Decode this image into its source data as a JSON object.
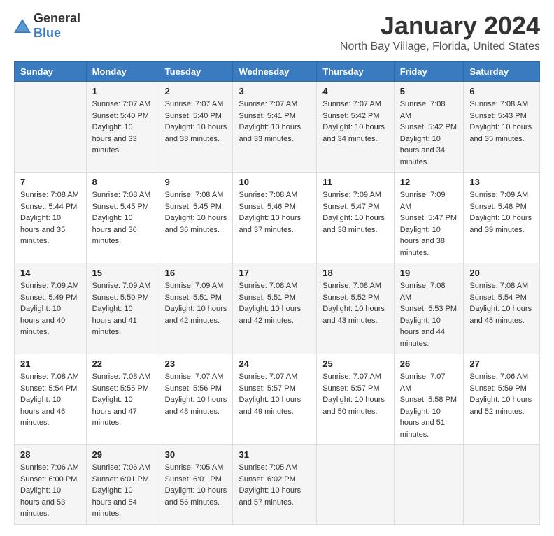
{
  "logo": {
    "general": "General",
    "blue": "Blue"
  },
  "header": {
    "title": "January 2024",
    "subtitle": "North Bay Village, Florida, United States"
  },
  "weekdays": [
    "Sunday",
    "Monday",
    "Tuesday",
    "Wednesday",
    "Thursday",
    "Friday",
    "Saturday"
  ],
  "weeks": [
    [
      {
        "day": "",
        "sunrise": "",
        "sunset": "",
        "daylight": ""
      },
      {
        "day": "1",
        "sunrise": "Sunrise: 7:07 AM",
        "sunset": "Sunset: 5:40 PM",
        "daylight": "Daylight: 10 hours and 33 minutes."
      },
      {
        "day": "2",
        "sunrise": "Sunrise: 7:07 AM",
        "sunset": "Sunset: 5:40 PM",
        "daylight": "Daylight: 10 hours and 33 minutes."
      },
      {
        "day": "3",
        "sunrise": "Sunrise: 7:07 AM",
        "sunset": "Sunset: 5:41 PM",
        "daylight": "Daylight: 10 hours and 33 minutes."
      },
      {
        "day": "4",
        "sunrise": "Sunrise: 7:07 AM",
        "sunset": "Sunset: 5:42 PM",
        "daylight": "Daylight: 10 hours and 34 minutes."
      },
      {
        "day": "5",
        "sunrise": "Sunrise: 7:08 AM",
        "sunset": "Sunset: 5:42 PM",
        "daylight": "Daylight: 10 hours and 34 minutes."
      },
      {
        "day": "6",
        "sunrise": "Sunrise: 7:08 AM",
        "sunset": "Sunset: 5:43 PM",
        "daylight": "Daylight: 10 hours and 35 minutes."
      }
    ],
    [
      {
        "day": "7",
        "sunrise": "Sunrise: 7:08 AM",
        "sunset": "Sunset: 5:44 PM",
        "daylight": "Daylight: 10 hours and 35 minutes."
      },
      {
        "day": "8",
        "sunrise": "Sunrise: 7:08 AM",
        "sunset": "Sunset: 5:45 PM",
        "daylight": "Daylight: 10 hours and 36 minutes."
      },
      {
        "day": "9",
        "sunrise": "Sunrise: 7:08 AM",
        "sunset": "Sunset: 5:45 PM",
        "daylight": "Daylight: 10 hours and 36 minutes."
      },
      {
        "day": "10",
        "sunrise": "Sunrise: 7:08 AM",
        "sunset": "Sunset: 5:46 PM",
        "daylight": "Daylight: 10 hours and 37 minutes."
      },
      {
        "day": "11",
        "sunrise": "Sunrise: 7:09 AM",
        "sunset": "Sunset: 5:47 PM",
        "daylight": "Daylight: 10 hours and 38 minutes."
      },
      {
        "day": "12",
        "sunrise": "Sunrise: 7:09 AM",
        "sunset": "Sunset: 5:47 PM",
        "daylight": "Daylight: 10 hours and 38 minutes."
      },
      {
        "day": "13",
        "sunrise": "Sunrise: 7:09 AM",
        "sunset": "Sunset: 5:48 PM",
        "daylight": "Daylight: 10 hours and 39 minutes."
      }
    ],
    [
      {
        "day": "14",
        "sunrise": "Sunrise: 7:09 AM",
        "sunset": "Sunset: 5:49 PM",
        "daylight": "Daylight: 10 hours and 40 minutes."
      },
      {
        "day": "15",
        "sunrise": "Sunrise: 7:09 AM",
        "sunset": "Sunset: 5:50 PM",
        "daylight": "Daylight: 10 hours and 41 minutes."
      },
      {
        "day": "16",
        "sunrise": "Sunrise: 7:09 AM",
        "sunset": "Sunset: 5:51 PM",
        "daylight": "Daylight: 10 hours and 42 minutes."
      },
      {
        "day": "17",
        "sunrise": "Sunrise: 7:08 AM",
        "sunset": "Sunset: 5:51 PM",
        "daylight": "Daylight: 10 hours and 42 minutes."
      },
      {
        "day": "18",
        "sunrise": "Sunrise: 7:08 AM",
        "sunset": "Sunset: 5:52 PM",
        "daylight": "Daylight: 10 hours and 43 minutes."
      },
      {
        "day": "19",
        "sunrise": "Sunrise: 7:08 AM",
        "sunset": "Sunset: 5:53 PM",
        "daylight": "Daylight: 10 hours and 44 minutes."
      },
      {
        "day": "20",
        "sunrise": "Sunrise: 7:08 AM",
        "sunset": "Sunset: 5:54 PM",
        "daylight": "Daylight: 10 hours and 45 minutes."
      }
    ],
    [
      {
        "day": "21",
        "sunrise": "Sunrise: 7:08 AM",
        "sunset": "Sunset: 5:54 PM",
        "daylight": "Daylight: 10 hours and 46 minutes."
      },
      {
        "day": "22",
        "sunrise": "Sunrise: 7:08 AM",
        "sunset": "Sunset: 5:55 PM",
        "daylight": "Daylight: 10 hours and 47 minutes."
      },
      {
        "day": "23",
        "sunrise": "Sunrise: 7:07 AM",
        "sunset": "Sunset: 5:56 PM",
        "daylight": "Daylight: 10 hours and 48 minutes."
      },
      {
        "day": "24",
        "sunrise": "Sunrise: 7:07 AM",
        "sunset": "Sunset: 5:57 PM",
        "daylight": "Daylight: 10 hours and 49 minutes."
      },
      {
        "day": "25",
        "sunrise": "Sunrise: 7:07 AM",
        "sunset": "Sunset: 5:57 PM",
        "daylight": "Daylight: 10 hours and 50 minutes."
      },
      {
        "day": "26",
        "sunrise": "Sunrise: 7:07 AM",
        "sunset": "Sunset: 5:58 PM",
        "daylight": "Daylight: 10 hours and 51 minutes."
      },
      {
        "day": "27",
        "sunrise": "Sunrise: 7:06 AM",
        "sunset": "Sunset: 5:59 PM",
        "daylight": "Daylight: 10 hours and 52 minutes."
      }
    ],
    [
      {
        "day": "28",
        "sunrise": "Sunrise: 7:06 AM",
        "sunset": "Sunset: 6:00 PM",
        "daylight": "Daylight: 10 hours and 53 minutes."
      },
      {
        "day": "29",
        "sunrise": "Sunrise: 7:06 AM",
        "sunset": "Sunset: 6:01 PM",
        "daylight": "Daylight: 10 hours and 54 minutes."
      },
      {
        "day": "30",
        "sunrise": "Sunrise: 7:05 AM",
        "sunset": "Sunset: 6:01 PM",
        "daylight": "Daylight: 10 hours and 56 minutes."
      },
      {
        "day": "31",
        "sunrise": "Sunrise: 7:05 AM",
        "sunset": "Sunset: 6:02 PM",
        "daylight": "Daylight: 10 hours and 57 minutes."
      },
      {
        "day": "",
        "sunrise": "",
        "sunset": "",
        "daylight": ""
      },
      {
        "day": "",
        "sunrise": "",
        "sunset": "",
        "daylight": ""
      },
      {
        "day": "",
        "sunrise": "",
        "sunset": "",
        "daylight": ""
      }
    ]
  ]
}
